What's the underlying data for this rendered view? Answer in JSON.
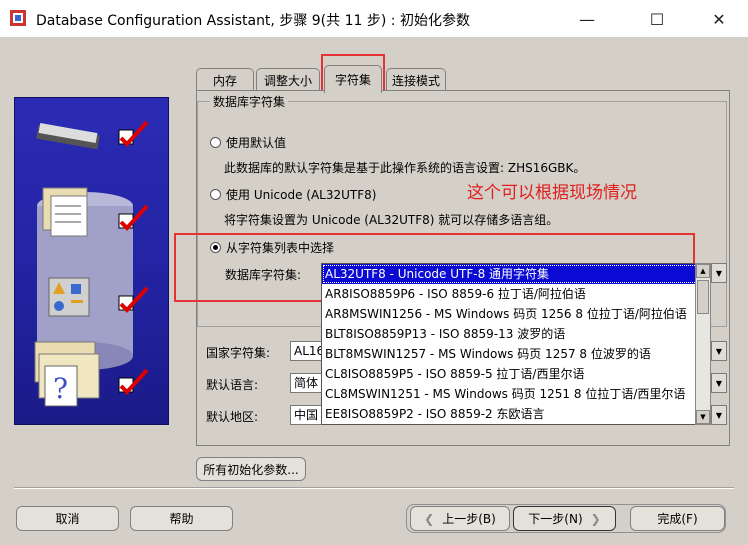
{
  "window": {
    "title": "Database Configuration Assistant, 步骤 9(共 11 步) : 初始化参数",
    "minimize": "—",
    "maximize": "☐",
    "close": "✕"
  },
  "tabs": [
    {
      "label": "内存"
    },
    {
      "label": "调整大小"
    },
    {
      "label": "字符集"
    },
    {
      "label": "连接模式"
    }
  ],
  "active_tab": "字符集",
  "db_charset_group": {
    "title": "数据库字符集",
    "option_default": {
      "label": "使用默认值",
      "description": "此数据库的默认字符集是基于此操作系统的语言设置: ZHS16GBK。"
    },
    "option_unicode": {
      "label": "使用 Unicode (AL32UTF8)",
      "description": "将字符集设置为 Unicode (AL32UTF8) 就可以存储多语言组。"
    },
    "option_list": {
      "label": "从字符集列表中选择",
      "field_label": "数据库字符集:",
      "selected": "AL32UTF8 - Unicode UTF-8 通用字符集"
    }
  },
  "annotation": "这个可以根据现场情况",
  "dropdown_items": [
    "AL32UTF8 - Unicode UTF-8 通用字符集",
    "AR8ISO8859P6 - ISO 8859-6 拉丁语/阿拉伯语",
    "AR8MSWIN1256 - MS Windows 码页 1256 8 位拉丁语/阿拉伯语",
    "BLT8ISO8859P13 - ISO 8859-13 波罗的语",
    "BLT8MSWIN1257 - MS Windows 码页 1257 8 位波罗的语",
    "CL8ISO8859P5 - ISO 8859-5 拉丁语/西里尔语",
    "CL8MSWIN1251 - MS Windows 码页 1251 8 位拉丁语/西里尔语",
    "EE8ISO8859P2 - ISO 8859-2 东欧语言"
  ],
  "national_charset": {
    "label": "国家字符集:",
    "value": "AL16"
  },
  "default_language": {
    "label": "默认语言:",
    "value": "简体"
  },
  "default_territory": {
    "label": "默认地区:",
    "value": "中国"
  },
  "all_params_button": "所有初始化参数...",
  "buttons": {
    "cancel": "取消",
    "help": "帮助",
    "back": "上一步(B)",
    "next": "下一步(N)",
    "finish": "完成(F)"
  }
}
